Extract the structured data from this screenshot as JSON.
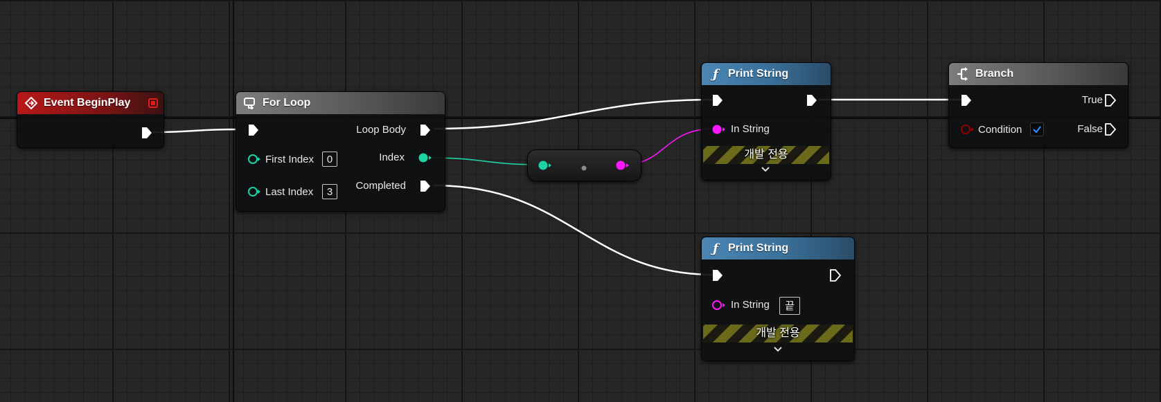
{
  "graph": {
    "nodes": {
      "event_begin_play": {
        "title": "Event BeginPlay",
        "icon": "event-icon",
        "header_color": "#b81818",
        "delegate_pin_color": "#e21d1d"
      },
      "for_loop": {
        "title": "For Loop",
        "icon": "loop-icon",
        "header_color": "#6e6e6e",
        "pins": {
          "first_index_label": "First Index",
          "first_index_value": "0",
          "last_index_label": "Last Index",
          "last_index_value": "3",
          "loop_body_label": "Loop Body",
          "index_label": "Index",
          "completed_label": "Completed"
        }
      },
      "print_string_1": {
        "title": "Print String",
        "icon": "function-icon",
        "header_color": "#4a86b5",
        "in_string_label": "In String",
        "dev_only_label": "개발 전용"
      },
      "print_string_2": {
        "title": "Print String",
        "icon": "function-icon",
        "header_color": "#4a86b5",
        "in_string_label": "In String",
        "in_string_value": "끝",
        "dev_only_label": "개발 전용"
      },
      "branch": {
        "title": "Branch",
        "icon": "branch-icon",
        "header_color": "#6e6e6e",
        "condition_label": "Condition",
        "condition_checked": true,
        "true_label": "True",
        "false_label": "False"
      },
      "conversion": {
        "icon": "conversion-node-icon",
        "input_color": "#1fd3a5",
        "output_color": "#ff18ff"
      }
    },
    "pin_colors": {
      "exec": "#ffffff",
      "integer": "#1fd3a5",
      "string": "#ff18ff",
      "boolean": "#8c0000"
    }
  }
}
